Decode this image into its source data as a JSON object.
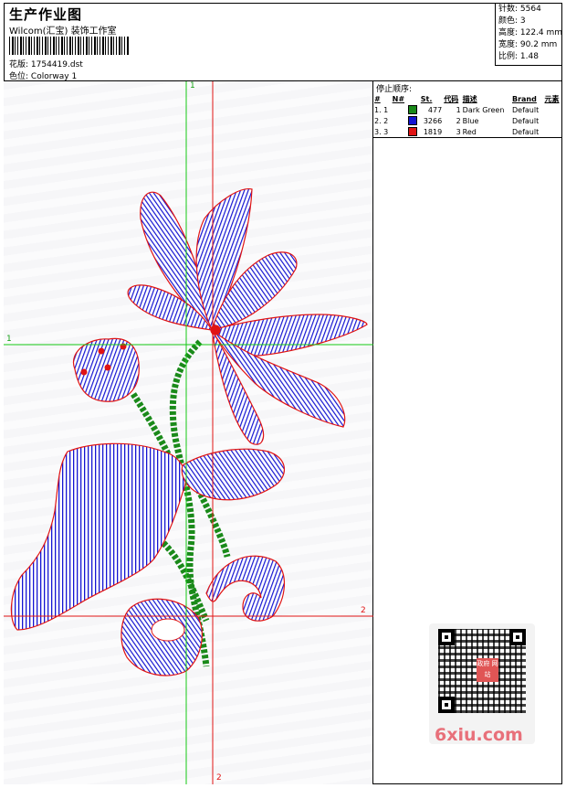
{
  "header": {
    "title": "生产作业图",
    "company": "Wilcom(汇宝) 装饰工作室",
    "pattern_label": "花版:",
    "pattern_value": "1754419.dst",
    "colorway_label": "色位:",
    "colorway_value": "Colorway 1"
  },
  "stats": {
    "stitches": "针数: 5564",
    "colors": "颜色: 3",
    "height": "高度: 122.4 mm",
    "width": "宽度: 90.2 mm",
    "scale": "比例: 1.48"
  },
  "guides": {
    "v1": "1",
    "h1": "1",
    "h2": "2",
    "v2": "2"
  },
  "stop_sequence": {
    "title": "停止顺序:",
    "columns": [
      "#",
      "N#",
      "St.",
      "代码",
      "描述",
      "Brand",
      "元素"
    ],
    "rows": [
      {
        "num": "1. 1",
        "color": "#1a8a1a",
        "stitches": "477",
        "code": "1",
        "desc": "Dark Green",
        "brand": "Default"
      },
      {
        "num": "2. 2",
        "color": "#1414d2",
        "stitches": "3266",
        "code": "2",
        "desc": "Blue",
        "brand": "Default"
      },
      {
        "num": "3. 3",
        "color": "#e01414",
        "stitches": "1819",
        "code": "3",
        "desc": "Red",
        "brand": "Default"
      }
    ]
  },
  "qr": {
    "badge": "政府 网站"
  },
  "watermark": "6xiu.com"
}
